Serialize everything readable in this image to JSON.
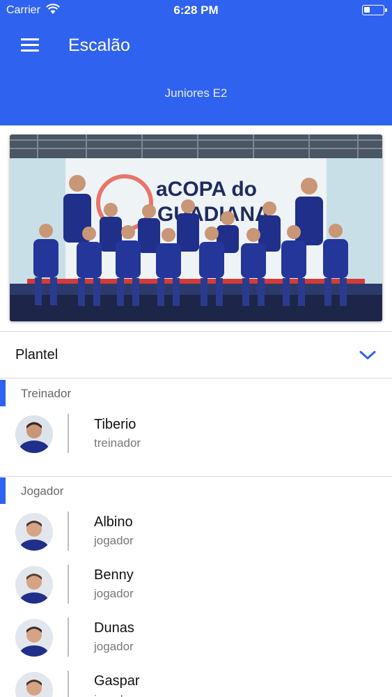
{
  "status_bar": {
    "carrier": "Carrier",
    "time": "6:28 PM"
  },
  "header": {
    "title": "Escalão",
    "subtitle": "Juniores E2"
  },
  "photo": {
    "banner_line1": "aCOPA do",
    "banner_line2": "GUADIANA"
  },
  "plantel": {
    "label": "Plantel"
  },
  "sections": {
    "treinador": {
      "label": "Treinador",
      "people": [
        {
          "name": "Tiberio",
          "role": "treinador"
        }
      ]
    },
    "jogador": {
      "label": "Jogador",
      "people": [
        {
          "name": "Albino",
          "role": "jogador"
        },
        {
          "name": "Benny",
          "role": "jogador"
        },
        {
          "name": "Dunas",
          "role": "jogador"
        },
        {
          "name": "Gaspar",
          "role": "jogador"
        }
      ]
    }
  },
  "colors": {
    "primary": "#2f62ee",
    "kit": "#1f2f8a"
  }
}
